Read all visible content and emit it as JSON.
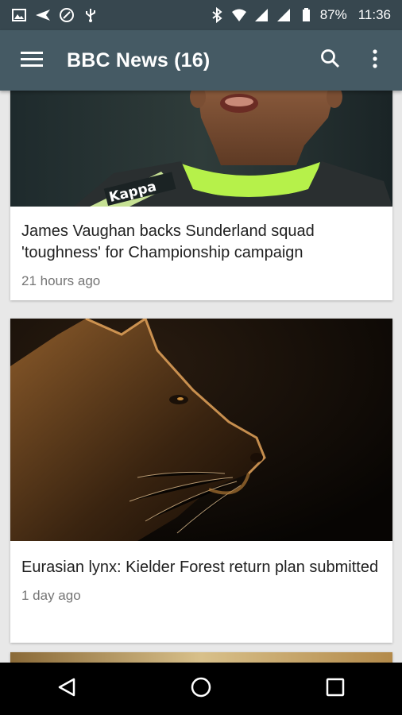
{
  "status_bar": {
    "battery": "87%",
    "time": "11:36",
    "left_icons": [
      "image-icon",
      "send-icon",
      "vpn-shield-icon",
      "usb-icon"
    ],
    "right_icons": [
      "bluetooth-icon",
      "wifi-icon",
      "signal-icon",
      "signal-icon",
      "battery-icon"
    ]
  },
  "app_bar": {
    "title": "BBC News (16)",
    "background": "#455a64",
    "status_background": "#37474f"
  },
  "articles": [
    {
      "headline": "James Vaughan backs Sunderland squad 'toughness' for Championship campaign",
      "time": "21 hours ago",
      "image_alt": "footballer-photo",
      "image_text": "Kappa"
    },
    {
      "headline": "Eurasian lynx: Kielder Forest return plan submitted",
      "time": "1 day ago",
      "image_alt": "lynx-photo"
    }
  ],
  "nav_bar": {
    "icons": [
      "back-icon",
      "home-icon",
      "recents-icon"
    ]
  }
}
